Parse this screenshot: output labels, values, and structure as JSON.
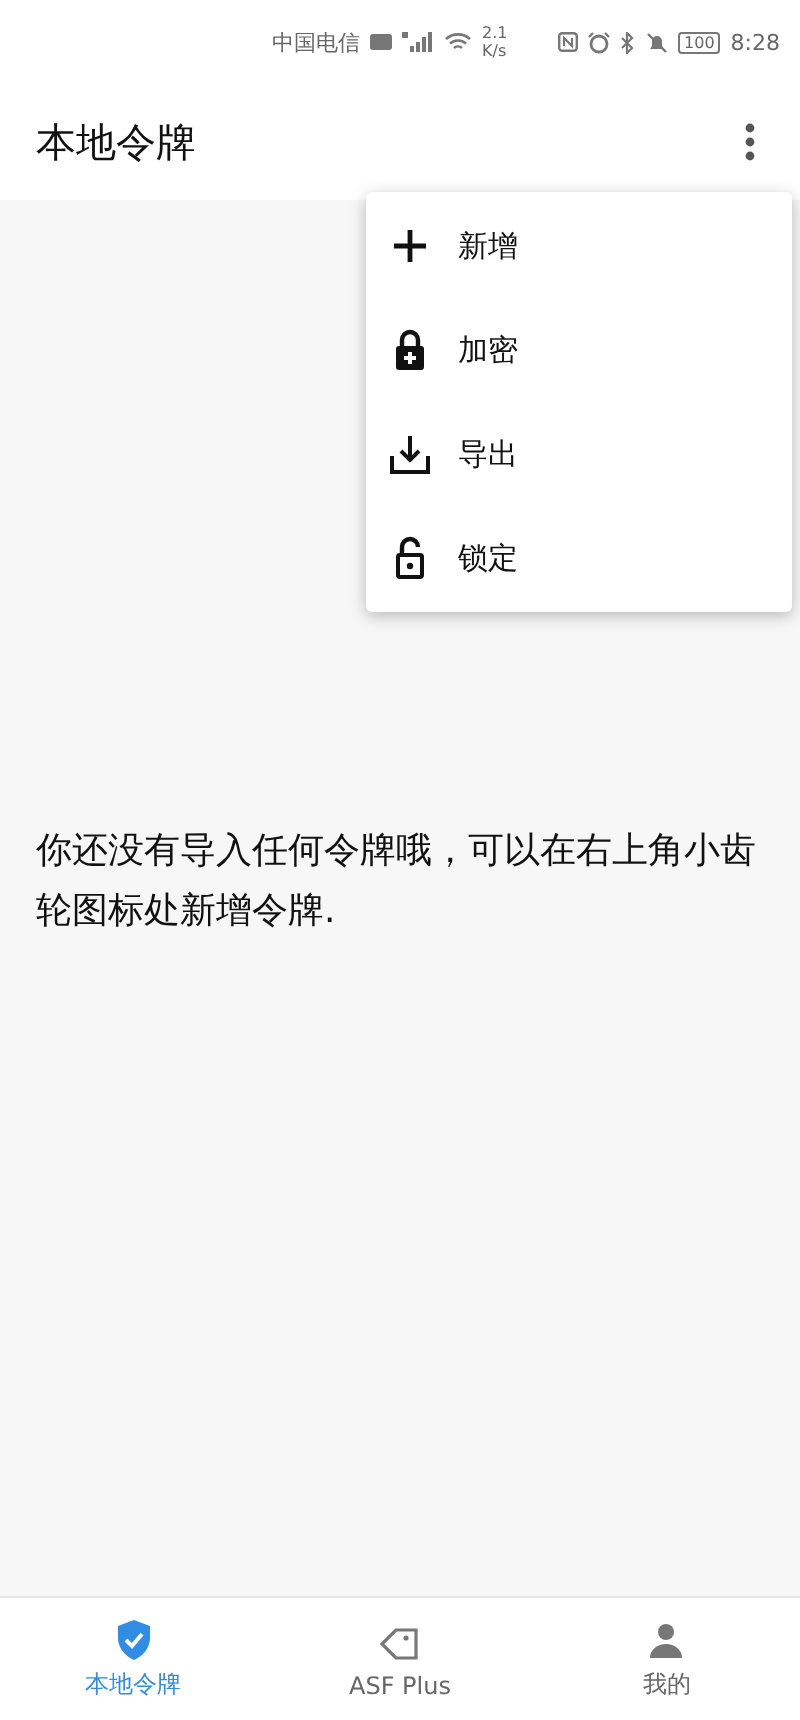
{
  "status_bar": {
    "carrier": "中国电信",
    "speed_value": "2.1",
    "speed_unit": "K/s",
    "battery": "100",
    "time": "8:28"
  },
  "app_bar": {
    "title": "本地令牌"
  },
  "menu": [
    {
      "kind": "add",
      "label": "新增"
    },
    {
      "kind": "encrypt",
      "label": "加密"
    },
    {
      "kind": "export",
      "label": "导出"
    },
    {
      "kind": "lock",
      "label": "锁定"
    }
  ],
  "empty_message": "你还没有导入任何令牌哦，可以在右上角小齿轮图标处新增令牌.",
  "tabs": [
    {
      "kind": "shield",
      "label": "本地令牌",
      "selected": true
    },
    {
      "kind": "tag",
      "label": "ASF Plus",
      "selected": false
    },
    {
      "kind": "person",
      "label": "我的",
      "selected": false
    }
  ]
}
